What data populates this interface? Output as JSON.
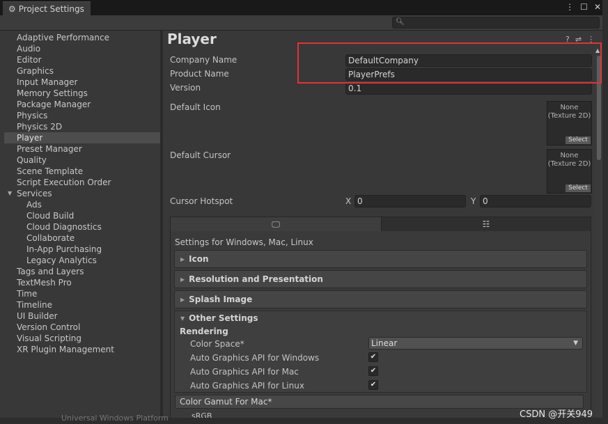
{
  "window": {
    "tab_title": "Project Settings",
    "tab_icon": "gear-icon",
    "controls": [
      "⋮",
      "☐",
      "✕"
    ]
  },
  "search": {
    "placeholder": "",
    "icon": "search-icon"
  },
  "sidebar": {
    "items": [
      {
        "label": "Adaptive Performance"
      },
      {
        "label": "Audio"
      },
      {
        "label": "Editor"
      },
      {
        "label": "Graphics"
      },
      {
        "label": "Input Manager"
      },
      {
        "label": "Memory Settings"
      },
      {
        "label": "Package Manager"
      },
      {
        "label": "Physics"
      },
      {
        "label": "Physics 2D"
      },
      {
        "label": "Player",
        "selected": true
      },
      {
        "label": "Preset Manager"
      },
      {
        "label": "Quality"
      },
      {
        "label": "Scene Template"
      },
      {
        "label": "Script Execution Order"
      },
      {
        "label": "Services",
        "expanded": true
      },
      {
        "label": "Ads",
        "child": true
      },
      {
        "label": "Cloud Build",
        "child": true
      },
      {
        "label": "Cloud Diagnostics",
        "child": true
      },
      {
        "label": "Collaborate",
        "child": true
      },
      {
        "label": "In-App Purchasing",
        "child": true
      },
      {
        "label": "Legacy Analytics",
        "child": true
      },
      {
        "label": "Tags and Layers"
      },
      {
        "label": "TextMesh Pro"
      },
      {
        "label": "Time"
      },
      {
        "label": "Timeline"
      },
      {
        "label": "UI Builder"
      },
      {
        "label": "Version Control"
      },
      {
        "label": "Visual Scripting"
      },
      {
        "label": "XR Plugin Management"
      }
    ]
  },
  "player": {
    "title": "Player",
    "header_icons": [
      "?",
      "⇌",
      "⋮"
    ],
    "company_name_label": "Company Name",
    "company_name": "DefaultCompany",
    "product_name_label": "Product Name",
    "product_name": "PlayerPrefs",
    "version_label": "Version",
    "version": "0.1",
    "default_icon_label": "Default Icon",
    "default_cursor_label": "Default Cursor",
    "texture_none": "None",
    "texture_type": "(Texture 2D)",
    "texture_select": "Select",
    "cursor_hotspot_label": "Cursor Hotspot",
    "hotspot_x_label": "X",
    "hotspot_x": "0",
    "hotspot_y_label": "Y",
    "hotspot_y": "0"
  },
  "platform": {
    "tabs": [
      {
        "icon": "monitor-icon"
      },
      {
        "icon": "server-icon"
      }
    ],
    "settings_label": "Settings for Windows, Mac, Linux",
    "sections": [
      "Icon",
      "Resolution and Presentation",
      "Splash Image",
      "Other Settings"
    ],
    "rendering_label": "Rendering",
    "color_space_label": "Color Space*",
    "color_space_value": "Linear",
    "auto_api_windows": "Auto Graphics API  for Windows",
    "auto_api_mac": "Auto Graphics API  for Mac",
    "auto_api_linux": "Auto Graphics API  for Linux",
    "auto_api_checked": [
      true,
      true,
      true
    ],
    "color_gamut_label": "Color Gamut For Mac*",
    "srgb": "sRGB"
  },
  "background": {
    "partial_text": "Universal Windows Platform"
  },
  "watermark": "CSDN @开关949",
  "colors": {
    "highlight": "#e23333",
    "selected_row": "#4d4d4d"
  }
}
